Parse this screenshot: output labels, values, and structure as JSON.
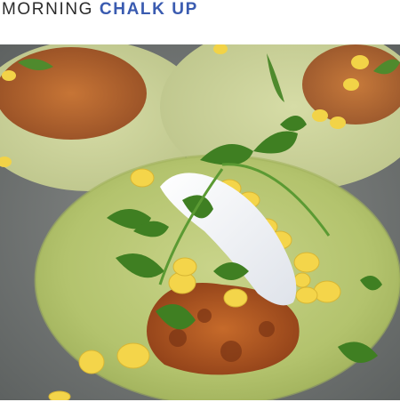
{
  "header": {
    "brand_light": "MORNING",
    "brand_bold": "CHALK UP"
  },
  "image": {
    "alt": "Tacos on green tortillas with shredded meat, corn, cilantro and crema"
  },
  "colors": {
    "brand_dark": "#2b2b2b",
    "brand_blue": "#3a5bb0"
  }
}
